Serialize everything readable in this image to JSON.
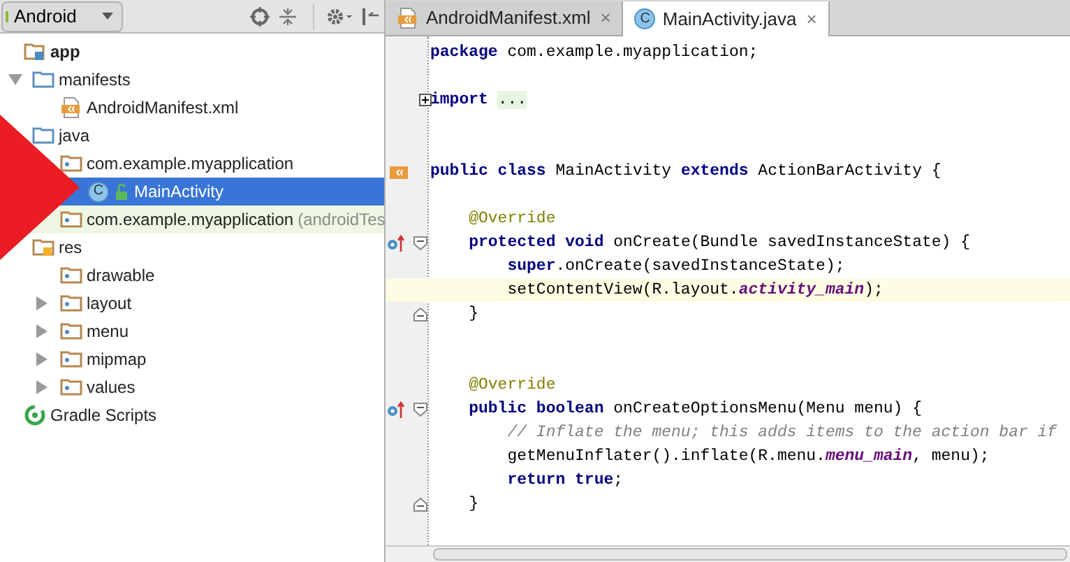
{
  "project_panel": {
    "view_selector": {
      "label": "Android"
    },
    "tree": [
      {
        "label": "app",
        "kind": "module",
        "selected": false,
        "children": [
          {
            "label": "manifests",
            "kind": "folder",
            "expanded": true,
            "selected": false,
            "children": [
              {
                "label": "AndroidManifest.xml",
                "kind": "manifest",
                "selected": false
              }
            ]
          },
          {
            "label": "java",
            "kind": "folder",
            "selected": false,
            "children": [
              {
                "label": "com.example.myapplication",
                "kind": "package",
                "selected": false,
                "children": [
                  {
                    "label": "MainActivity",
                    "kind": "class",
                    "badge": "C",
                    "selected": true
                  }
                ]
              },
              {
                "label": "com.example.myapplication",
                "suffix": "(androidTes",
                "kind": "test-package",
                "selected": false
              }
            ]
          },
          {
            "label": "res",
            "kind": "res-folder",
            "selected": false,
            "children": [
              {
                "label": "drawable",
                "kind": "package",
                "selected": false
              },
              {
                "label": "layout",
                "kind": "package",
                "expanded": false,
                "selected": false
              },
              {
                "label": "menu",
                "kind": "package",
                "expanded": false,
                "selected": false
              },
              {
                "label": "mipmap",
                "kind": "package",
                "expanded": false,
                "selected": false
              },
              {
                "label": "values",
                "kind": "package",
                "expanded": false,
                "selected": false
              }
            ]
          }
        ]
      },
      {
        "label": "Gradle Scripts",
        "kind": "gradle",
        "selected": false
      }
    ]
  },
  "editor": {
    "tabs": [
      {
        "label": "AndroidManifest.xml",
        "kind": "manifest",
        "close": "×",
        "selected": false
      },
      {
        "label": "MainActivity.java",
        "kind": "class",
        "badge": "C",
        "close": "×",
        "selected": true
      }
    ],
    "lines": [
      {
        "kind": "code",
        "tokens": [
          {
            "text": "package",
            "kind": "keyword"
          },
          {
            "text": " com.example.myapplication;",
            "kind": "plain"
          }
        ]
      },
      {
        "kind": "blank"
      },
      {
        "kind": "code",
        "fold": {
          "kind": "plus"
        },
        "tokens": [
          {
            "text": "import ",
            "kind": "keyword"
          },
          {
            "text": "...",
            "kind": "folded"
          }
        ]
      },
      {
        "kind": "blank"
      },
      {
        "kind": "blank"
      },
      {
        "kind": "code",
        "gutter": {
          "kind": "class"
        },
        "tokens": [
          {
            "text": "public class",
            "kind": "keyword"
          },
          {
            "text": " MainActivity ",
            "kind": "plain"
          },
          {
            "text": "extends",
            "kind": "keyword"
          },
          {
            "text": " ActionBarActivity {",
            "kind": "plain"
          }
        ]
      },
      {
        "kind": "blank"
      },
      {
        "kind": "code",
        "tokens": [
          {
            "text": "    @Override",
            "kind": "annotation"
          }
        ]
      },
      {
        "kind": "code",
        "gutter": {
          "kind": "override"
        },
        "fold": {
          "kind": "start"
        },
        "tokens": [
          {
            "text": "    protected void",
            "kind": "keyword"
          },
          {
            "text": " onCreate(Bundle savedInstanceState) {",
            "kind": "plain"
          }
        ]
      },
      {
        "kind": "code",
        "tokens": [
          {
            "text": "        super",
            "kind": "keyword"
          },
          {
            "text": ".onCreate(savedInstanceState);",
            "kind": "plain"
          }
        ]
      },
      {
        "kind": "code",
        "current": true,
        "tokens": [
          {
            "text": "        setContentView(R.layout.",
            "kind": "plain"
          },
          {
            "text": "activity_main",
            "kind": "field"
          },
          {
            "text": ");",
            "kind": "plain"
          }
        ]
      },
      {
        "kind": "code",
        "fold": {
          "kind": "end"
        },
        "tokens": [
          {
            "text": "    }",
            "kind": "plain"
          }
        ]
      },
      {
        "kind": "blank"
      },
      {
        "kind": "blank"
      },
      {
        "kind": "code",
        "tokens": [
          {
            "text": "    @Override",
            "kind": "annotation"
          }
        ]
      },
      {
        "kind": "code",
        "gutter": {
          "kind": "override"
        },
        "fold": {
          "kind": "start"
        },
        "tokens": [
          {
            "text": "    public boolean",
            "kind": "keyword"
          },
          {
            "text": " onCreateOptionsMenu(Menu menu) {",
            "kind": "plain"
          }
        ]
      },
      {
        "kind": "code",
        "tokens": [
          {
            "text": "        // Inflate the menu; this adds items to the action bar if",
            "kind": "comment"
          }
        ]
      },
      {
        "kind": "code",
        "tokens": [
          {
            "text": "        getMenuInflater().inflate(R.menu.",
            "kind": "plain"
          },
          {
            "text": "menu_main",
            "kind": "field"
          },
          {
            "text": ", menu);",
            "kind": "plain"
          }
        ]
      },
      {
        "kind": "code",
        "tokens": [
          {
            "text": "        return true",
            "kind": "keyword"
          },
          {
            "text": ";",
            "kind": "plain"
          }
        ]
      },
      {
        "kind": "code",
        "fold": {
          "kind": "end"
        },
        "tokens": [
          {
            "text": "    }",
            "kind": "plain"
          }
        ]
      }
    ]
  }
}
